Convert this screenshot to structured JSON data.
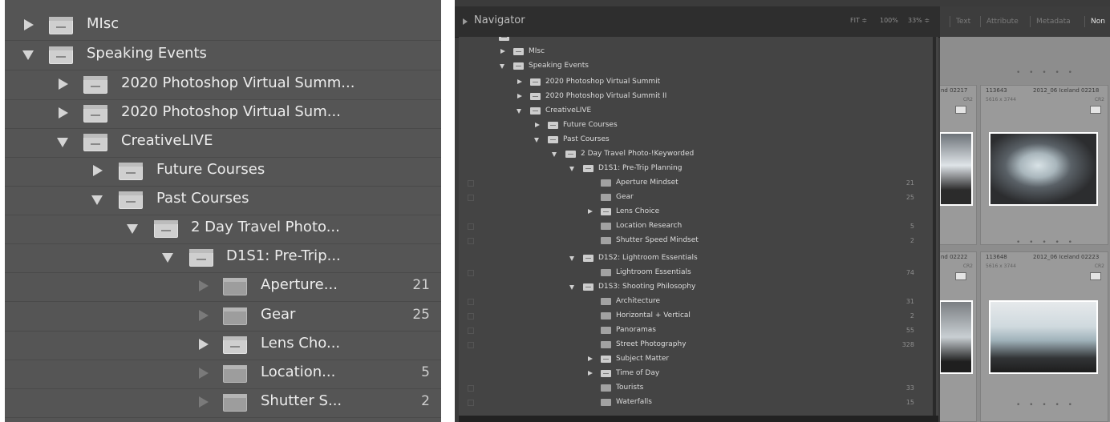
{
  "left_panel": {
    "rows": [
      {
        "label": "MIsc",
        "count": "",
        "expanded": false
      },
      {
        "label": "Speaking Events",
        "count": "",
        "expanded": true
      },
      {
        "label": "2020 Photoshop Virtual Summ...",
        "count": "",
        "expanded": false
      },
      {
        "label": "2020 Photoshop Virtual Sum...",
        "count": "",
        "expanded": false
      },
      {
        "label": "CreativeLIVE",
        "count": "",
        "expanded": true
      },
      {
        "label": "Future Courses",
        "count": "",
        "expanded": false
      },
      {
        "label": "Past Courses",
        "count": "",
        "expanded": true
      },
      {
        "label": "2 Day Travel Photo...",
        "count": "",
        "expanded": true
      },
      {
        "label": "D1S1: Pre-Trip...",
        "count": "",
        "expanded": true
      },
      {
        "label": "Aperture...",
        "count": "21",
        "expanded": false
      },
      {
        "label": "Gear",
        "count": "25",
        "expanded": false
      },
      {
        "label": "Lens Cho...",
        "count": "",
        "expanded": false
      },
      {
        "label": "Location...",
        "count": "5",
        "expanded": false
      },
      {
        "label": "Shutter S...",
        "count": "2",
        "expanded": false
      }
    ]
  },
  "navigator": {
    "title": "Navigator",
    "zoom_options": [
      "FIT ≑",
      "100%",
      "33% ≑"
    ]
  },
  "filter_bar": {
    "items": [
      "Text",
      "Attribute",
      "Metadata",
      "Non"
    ]
  },
  "tree": {
    "rows": [
      {
        "label": "MIsc",
        "count": ""
      },
      {
        "label": "Speaking Events",
        "count": ""
      },
      {
        "label": "2020 Photoshop Virtual Summit",
        "count": ""
      },
      {
        "label": "2020 Photoshop Virtual Summit II",
        "count": ""
      },
      {
        "label": "CreativeLIVE",
        "count": ""
      },
      {
        "label": "Future Courses",
        "count": ""
      },
      {
        "label": "Past Courses",
        "count": ""
      },
      {
        "label": "2 Day Travel Photo-!Keyworded",
        "count": ""
      },
      {
        "label": "D1S1: Pre-Trip Planning",
        "count": ""
      },
      {
        "label": "Aperture Mindset",
        "count": "21"
      },
      {
        "label": "Gear",
        "count": "25"
      },
      {
        "label": "Lens Choice",
        "count": ""
      },
      {
        "label": "Location Research",
        "count": "5"
      },
      {
        "label": "Shutter Speed Mindset",
        "count": "2"
      },
      {
        "label": "D1S2: Lightroom Essentials",
        "count": ""
      },
      {
        "label": "Lightroom Essentials",
        "count": "74"
      },
      {
        "label": "D1S3: Shooting Philosophy",
        "count": ""
      },
      {
        "label": "Architecture",
        "count": "31"
      },
      {
        "label": "Horizontal + Vertical",
        "count": "2"
      },
      {
        "label": "Panoramas",
        "count": "55"
      },
      {
        "label": "Street Photography",
        "count": "328"
      },
      {
        "label": "Subject Matter",
        "count": ""
      },
      {
        "label": "Time of Day",
        "count": ""
      },
      {
        "label": "Tourists",
        "count": "33"
      },
      {
        "label": "Waterfalls",
        "count": "15"
      }
    ]
  },
  "grid": {
    "cells": [
      {
        "name": "nd 02217",
        "file": "",
        "dims": "CR2"
      },
      {
        "name": "2012_06 Iceland 02218",
        "file": "113643",
        "dims": "5616 x 3744",
        "ext": "CR2"
      },
      {
        "name": "nd 02222",
        "file": "",
        "dims": "CR2"
      },
      {
        "name": "2012_06 Iceland 02223",
        "file": "113648",
        "dims": "5616 x 3744",
        "ext": "CR2"
      }
    ]
  }
}
